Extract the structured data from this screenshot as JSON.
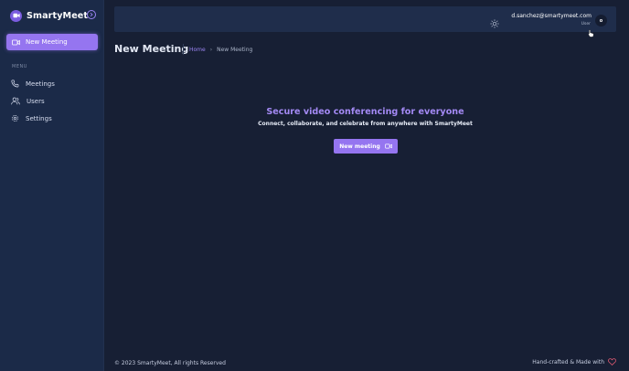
{
  "brand": {
    "name": "SmartyMeet",
    "accent": "#9575f0"
  },
  "sidebar": {
    "new_meeting_label": "New Meeting",
    "menu_heading": "MENU",
    "items": [
      {
        "label": "Meetings",
        "icon": "phone-icon"
      },
      {
        "label": "Users",
        "icon": "users-icon"
      },
      {
        "label": "Settings",
        "icon": "gear-icon"
      }
    ]
  },
  "header": {
    "email": "d.sanchez@smartymeet.com",
    "role": "User",
    "avatar_initial": "o"
  },
  "page": {
    "title": "New Meeting",
    "breadcrumb": {
      "home": "Home",
      "current": "New Meeting"
    }
  },
  "hero": {
    "title": "Secure video conferencing for everyone",
    "subtitle": "Connect, collaborate, and celebrate from anywhere with SmartyMeet",
    "button_label": "New meeting"
  },
  "footer": {
    "copyright": "© 2023 SmartyMeet, All rights Reserved",
    "credit": "Hand-crafted & Made with"
  }
}
